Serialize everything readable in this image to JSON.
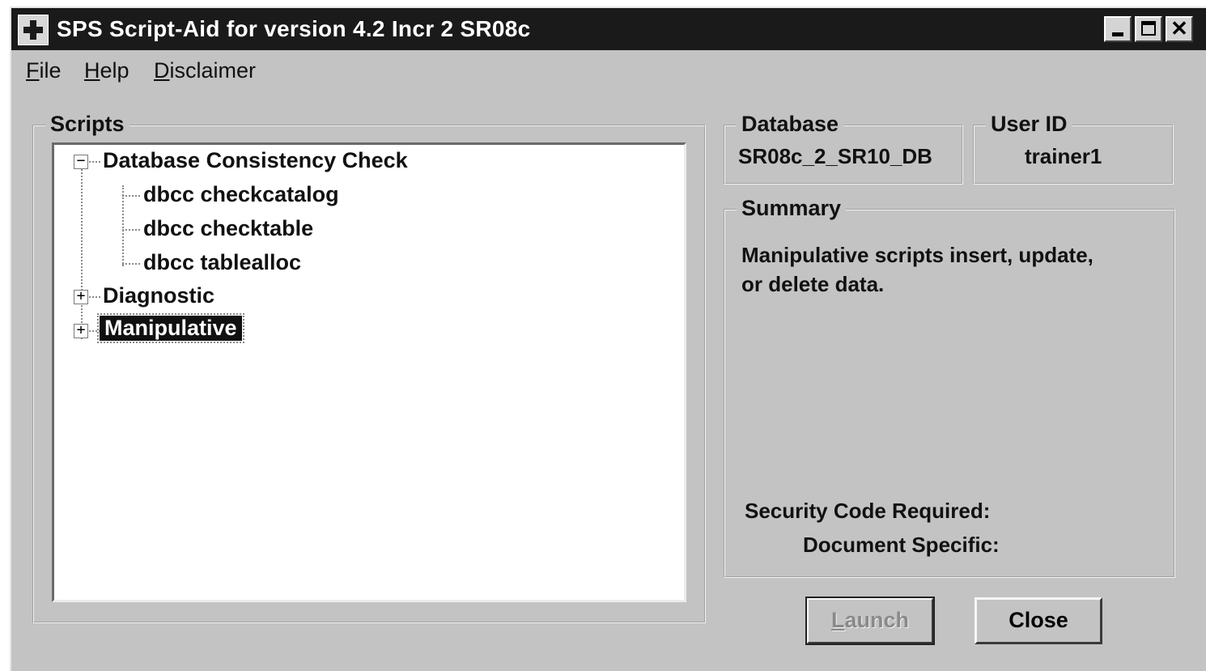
{
  "window": {
    "title": "SPS Script-Aid for version 4.2 Incr 2 SR08c",
    "minimize_symbol": "",
    "maximize_symbol": "",
    "close_symbol": "✕"
  },
  "menu": {
    "file": {
      "mnemonic": "F",
      "rest": "ile"
    },
    "help": {
      "mnemonic": "H",
      "rest": "elp"
    },
    "disclaimer": {
      "mnemonic": "D",
      "rest": "isclaimer"
    }
  },
  "scripts": {
    "legend": "Scripts",
    "tree": [
      {
        "label": "Database Consistency Check",
        "expander": "−",
        "children": [
          "dbcc checkcatalog",
          "dbcc checktable",
          "dbcc tablealloc"
        ]
      },
      {
        "label": "Diagnostic",
        "expander": "+"
      },
      {
        "label": "Manipulative",
        "expander": "+",
        "selected": true
      }
    ]
  },
  "database": {
    "legend": "Database",
    "value": "SR08c_2_SR10_DB"
  },
  "user": {
    "legend": "User ID",
    "value": "trainer1"
  },
  "summary": {
    "legend": "Summary",
    "text_line1": "Manipulative scripts insert, update,",
    "text_line2": "or delete data.",
    "security_label": "Security Code Required:",
    "document_label": "Document Specific:"
  },
  "buttons": {
    "launch": {
      "mnemonic": "L",
      "rest": "aunch",
      "enabled": false
    },
    "close": "Close"
  },
  "colors": {
    "titlebar": "#1a1a1a",
    "window": "#c3c3c3",
    "selection": "#111111"
  }
}
